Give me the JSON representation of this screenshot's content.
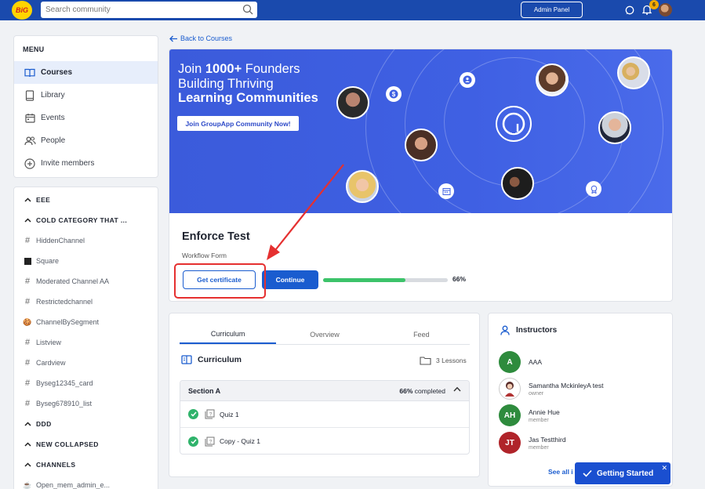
{
  "topbar": {
    "logo_text": "BiG",
    "search_placeholder": "Search community",
    "admin_panel_label": "Admin Panel",
    "notification_count": "6"
  },
  "menu": {
    "title": "MENU",
    "items": [
      {
        "label": "Courses",
        "icon": "book-open-icon",
        "active": true
      },
      {
        "label": "Library",
        "icon": "library-icon"
      },
      {
        "label": "Events",
        "icon": "calendar-icon"
      },
      {
        "label": "People",
        "icon": "people-icon"
      },
      {
        "label": "Invite members",
        "icon": "plus-circle-icon"
      }
    ]
  },
  "channels": [
    {
      "label": "EEE",
      "type": "category"
    },
    {
      "label": "COLD CATEGORY THAT ...",
      "type": "category"
    },
    {
      "label": "HiddenChannel",
      "type": "hash"
    },
    {
      "label": "Square",
      "type": "square"
    },
    {
      "label": "Moderated Channel AA",
      "type": "hash"
    },
    {
      "label": "Restrictedchannel",
      "type": "hash"
    },
    {
      "label": "ChannelBySegment",
      "type": "emoji",
      "emoji": "🍪"
    },
    {
      "label": "Listview",
      "type": "hash"
    },
    {
      "label": "Cardview",
      "type": "hash"
    },
    {
      "label": "Byseg12345_card",
      "type": "hash"
    },
    {
      "label": "Byseg678910_list",
      "type": "hash"
    },
    {
      "label": "DDD",
      "type": "category"
    },
    {
      "label": "NEW COLLAPSED",
      "type": "category"
    },
    {
      "label": "CHANNELS",
      "type": "category"
    },
    {
      "label": "Open_mem_admin_e...",
      "type": "emoji",
      "emoji": "☕"
    }
  ],
  "back_link": "Back to Courses",
  "banner": {
    "line1_pre": "Join ",
    "line1_bold": "1000+",
    "line1_post": " Founders",
    "line2": "Building Thriving",
    "line3": "Learning Communities",
    "cta": "Join GroupApp Community Now!"
  },
  "course": {
    "title": "Enforce Test",
    "subtitle": "Workflow Form",
    "certificate_button": "Get certificate",
    "continue_button": "Continue",
    "progress": 0.66,
    "progress_label": "66%"
  },
  "curriculum": {
    "tabs": [
      "Curriculum",
      "Overview",
      "Feed"
    ],
    "active_tab": 0,
    "heading": "Curriculum",
    "lessons_count": "3 Lessons",
    "section": {
      "title": "Section A",
      "completed_pct": "66%",
      "completed_word": " completed",
      "lessons": [
        {
          "label": "Quiz 1",
          "done": true
        },
        {
          "label": "Copy - Quiz 1",
          "done": true
        }
      ]
    }
  },
  "instructors": {
    "heading": "Instructors",
    "list": [
      {
        "initials": "A",
        "name": "AAA",
        "role": "",
        "color": "#2e8b3d"
      },
      {
        "initials": "",
        "name": "Samantha MckinleyA test",
        "role": "owner",
        "color": "#ffffff"
      },
      {
        "initials": "AH",
        "name": "Annie Hue",
        "role": "member",
        "color": "#2e8b3d"
      },
      {
        "initials": "JT",
        "name": "Jas Testthird",
        "role": "member",
        "color": "#b0242a"
      }
    ],
    "see_all": "See all i"
  },
  "getting_started": "Getting Started",
  "colors": {
    "brand": "#1a4aad",
    "accent": "#1a5ccf",
    "success": "#2fb36b",
    "annotation": "#e53030"
  }
}
